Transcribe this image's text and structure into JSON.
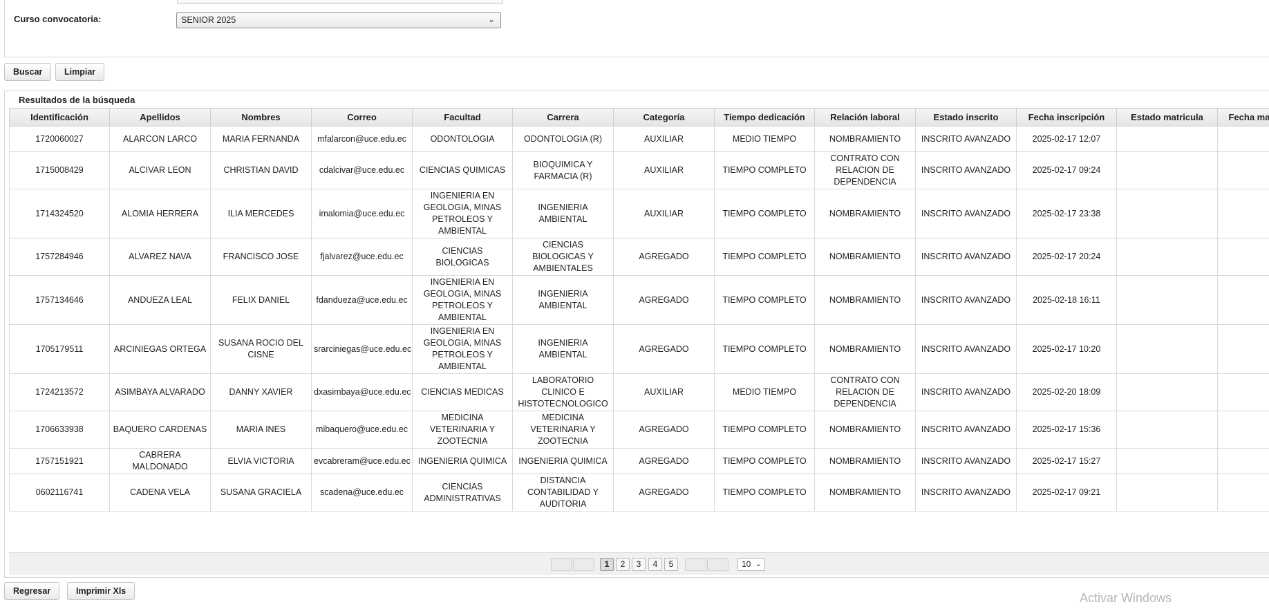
{
  "filter": {
    "label": "Curso convocatoria:",
    "selected": "SENIOR 2025",
    "chevron": "⌄"
  },
  "actions": {
    "search": "Buscar",
    "clear": "Limpiar"
  },
  "results": {
    "title": "Resultados de la búsqueda",
    "columns": [
      "Identificación",
      "Apellidos",
      "Nombres",
      "Correo",
      "Facultad",
      "Carrera",
      "Categoría",
      "Tiempo dedicación",
      "Relación laboral",
      "Estado inscrito",
      "Fecha inscripción",
      "Estado matricula",
      "Fecha ma"
    ],
    "rows": [
      {
        "id": "1720060027",
        "apellidos": "ALARCON LARCO",
        "nombres": "MARIA FERNANDA",
        "correo": "mfalarcon@uce.edu.ec",
        "facultad": "ODONTOLOGIA",
        "carrera": "ODONTOLOGIA (R)",
        "categoria": "AUXILIAR",
        "tiempo": "MEDIO TIEMPO",
        "relacion": "NOMBRAMIENTO",
        "estado": "INSCRITO AVANZADO",
        "fecha": "2025-02-17 12:07",
        "estado_matricula": "",
        "fecha_matricula": ""
      },
      {
        "id": "1715008429",
        "apellidos": "ALCIVAR LEON",
        "nombres": "CHRISTIAN DAVID",
        "correo": "cdalcivar@uce.edu.ec",
        "facultad": "CIENCIAS QUIMICAS",
        "carrera": "BIOQUIMICA Y FARMACIA (R)",
        "categoria": "AUXILIAR",
        "tiempo": "TIEMPO COMPLETO",
        "relacion": "CONTRATO CON RELACION DE DEPENDENCIA",
        "estado": "INSCRITO AVANZADO",
        "fecha": "2025-02-17 09:24",
        "estado_matricula": "",
        "fecha_matricula": ""
      },
      {
        "id": "1714324520",
        "apellidos": "ALOMIA HERRERA",
        "nombres": "ILIA MERCEDES",
        "correo": "imalomia@uce.edu.ec",
        "facultad": "INGENIERIA EN GEOLOGIA, MINAS PETROLEOS Y AMBIENTAL",
        "carrera": "INGENIERIA AMBIENTAL",
        "categoria": "AUXILIAR",
        "tiempo": "TIEMPO COMPLETO",
        "relacion": "NOMBRAMIENTO",
        "estado": "INSCRITO AVANZADO",
        "fecha": "2025-02-17 23:38",
        "estado_matricula": "",
        "fecha_matricula": ""
      },
      {
        "id": "1757284946",
        "apellidos": "ALVAREZ NAVA",
        "nombres": "FRANCISCO JOSE",
        "correo": "fjalvarez@uce.edu.ec",
        "facultad": "CIENCIAS BIOLOGICAS",
        "carrera": "CIENCIAS BIOLOGICAS Y AMBIENTALES",
        "categoria": "AGREGADO",
        "tiempo": "TIEMPO COMPLETO",
        "relacion": "NOMBRAMIENTO",
        "estado": "INSCRITO AVANZADO",
        "fecha": "2025-02-17 20:24",
        "estado_matricula": "",
        "fecha_matricula": ""
      },
      {
        "id": "1757134646",
        "apellidos": "ANDUEZA LEAL",
        "nombres": "FELIX DANIEL",
        "correo": "fdandueza@uce.edu.ec",
        "facultad": "INGENIERIA EN GEOLOGIA, MINAS PETROLEOS Y AMBIENTAL",
        "carrera": "INGENIERIA AMBIENTAL",
        "categoria": "AGREGADO",
        "tiempo": "TIEMPO COMPLETO",
        "relacion": "NOMBRAMIENTO",
        "estado": "INSCRITO AVANZADO",
        "fecha": "2025-02-18 16:11",
        "estado_matricula": "",
        "fecha_matricula": ""
      },
      {
        "id": "1705179511",
        "apellidos": "ARCINIEGAS ORTEGA",
        "nombres": "SUSANA ROCIO DEL CISNE",
        "correo": "srarciniegas@uce.edu.ec",
        "facultad": "INGENIERIA EN GEOLOGIA, MINAS PETROLEOS Y AMBIENTAL",
        "carrera": "INGENIERIA AMBIENTAL",
        "categoria": "AGREGADO",
        "tiempo": "TIEMPO COMPLETO",
        "relacion": "NOMBRAMIENTO",
        "estado": "INSCRITO AVANZADO",
        "fecha": "2025-02-17 10:20",
        "estado_matricula": "",
        "fecha_matricula": ""
      },
      {
        "id": "1724213572",
        "apellidos": "ASIMBAYA ALVARADO",
        "nombres": "DANNY XAVIER",
        "correo": "dxasimbaya@uce.edu.ec",
        "facultad": "CIENCIAS MEDICAS",
        "carrera": "LABORATORIO CLINICO E HISTOTECNOLOGICO",
        "categoria": "AUXILIAR",
        "tiempo": "MEDIO TIEMPO",
        "relacion": "CONTRATO CON RELACION DE DEPENDENCIA",
        "estado": "INSCRITO AVANZADO",
        "fecha": "2025-02-20 18:09",
        "estado_matricula": "",
        "fecha_matricula": ""
      },
      {
        "id": "1706633938",
        "apellidos": "BAQUERO CARDENAS",
        "nombres": "MARIA INES",
        "correo": "mibaquero@uce.edu.ec",
        "facultad": "MEDICINA VETERINARIA Y ZOOTECNIA",
        "carrera": "MEDICINA VETERINARIA Y ZOOTECNIA",
        "categoria": "AGREGADO",
        "tiempo": "TIEMPO COMPLETO",
        "relacion": "NOMBRAMIENTO",
        "estado": "INSCRITO AVANZADO",
        "fecha": "2025-02-17 15:36",
        "estado_matricula": "",
        "fecha_matricula": ""
      },
      {
        "id": "1757151921",
        "apellidos": "CABRERA MALDONADO",
        "nombres": "ELVIA VICTORIA",
        "correo": "evcabreram@uce.edu.ec",
        "facultad": "INGENIERIA QUIMICA",
        "carrera": "INGENIERIA QUIMICA",
        "categoria": "AGREGADO",
        "tiempo": "TIEMPO COMPLETO",
        "relacion": "NOMBRAMIENTO",
        "estado": "INSCRITO AVANZADO",
        "fecha": "2025-02-17 15:27",
        "estado_matricula": "",
        "fecha_matricula": ""
      },
      {
        "id": "0602116741",
        "apellidos": "CADENA VELA",
        "nombres": "SUSANA GRACIELA",
        "correo": "scadena@uce.edu.ec",
        "facultad": "CIENCIAS ADMINISTRATIVAS",
        "carrera": "DISTANCIA CONTABILIDAD Y AUDITORIA",
        "categoria": "AGREGADO",
        "tiempo": "TIEMPO COMPLETO",
        "relacion": "NOMBRAMIENTO",
        "estado": "INSCRITO AVANZADO",
        "fecha": "2025-02-17 09:21",
        "estado_matricula": "",
        "fecha_matricula": ""
      }
    ]
  },
  "pagination": {
    "pages": [
      "1",
      "2",
      "3",
      "4",
      "5"
    ],
    "current": "1",
    "rows_per_page": "10",
    "chevron": "⌄"
  },
  "footer": {
    "back": "Regresar",
    "export": "Imprimir Xls"
  },
  "watermark": "Activar Windows"
}
